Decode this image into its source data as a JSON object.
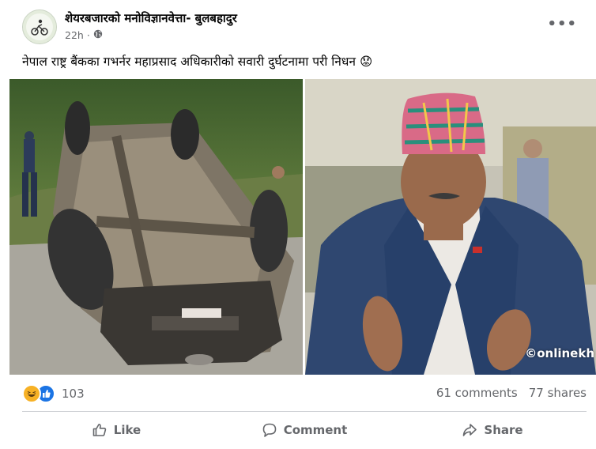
{
  "post": {
    "author": "शेयरबजारको मनोविज्ञानवेत्ता- बुलबहादुर",
    "time": "22h",
    "time_separator": "·",
    "text": "नेपाल राष्ट्र बैंकका गभर्नर महाप्रसाद अधिकारीको सवारी दुर्घटनामा परी निधन",
    "text_emoji": "😟",
    "menu": "•••"
  },
  "photos": {
    "watermark": "©onlinekh"
  },
  "stats": {
    "reaction_count": "103",
    "comments": "61 comments",
    "shares": "77 shares"
  },
  "actions": {
    "like": "Like",
    "comment": "Comment",
    "share": "Share"
  },
  "colors": {
    "secondary_text": "#65676b",
    "divider": "#ced0d4",
    "like_blue": "#1b74e4",
    "haha_yellow": "#f7b125"
  },
  "icons": [
    "globe-icon",
    "more-options-icon",
    "haha-reaction-icon",
    "like-reaction-icon",
    "like-icon",
    "comment-icon",
    "share-icon"
  ]
}
